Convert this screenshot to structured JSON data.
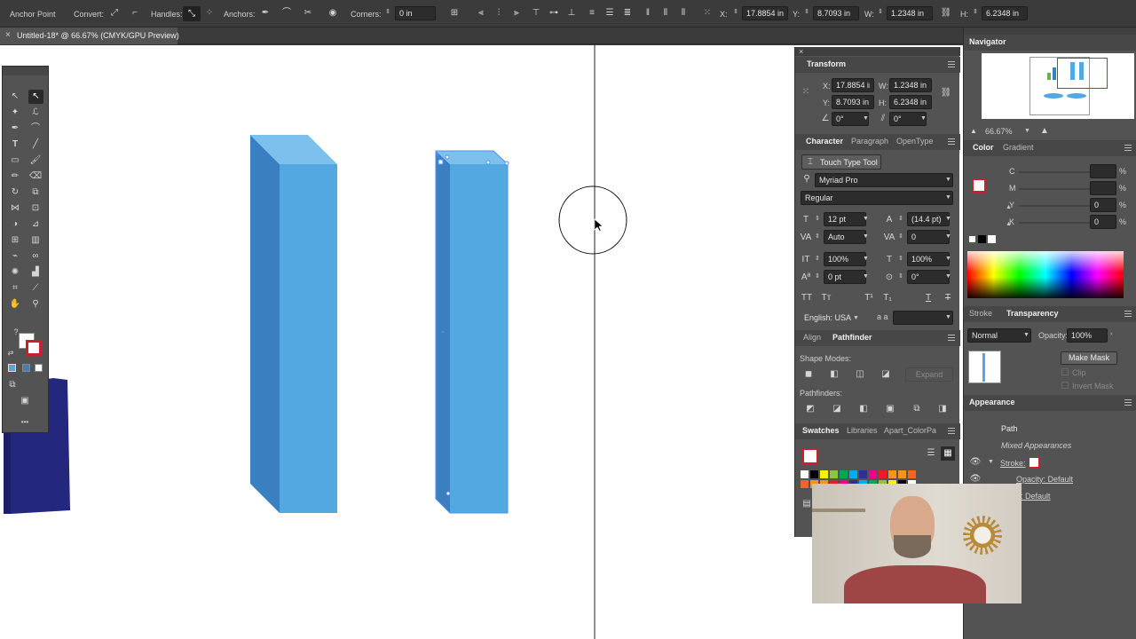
{
  "control_bar": {
    "selection_label": "Anchor Point",
    "convert_label": "Convert:",
    "handles_label": "Handles:",
    "anchors_label": "Anchors:",
    "corners_label": "Corners:",
    "corners_value": "0 in",
    "x_label": "X:",
    "x_value": "17.8854 in",
    "y_label": "Y:",
    "y_value": "8.7093 in",
    "w_label": "W:",
    "w_value": "1.2348 in",
    "h_label": "H:",
    "h_value": "6.2348 in"
  },
  "document_tab": {
    "title": "Untitled-18* @ 66.67% (CMYK/GPU Preview)",
    "close": "×"
  },
  "toolbar": {
    "more": "•••",
    "question": "?"
  },
  "transform": {
    "title": "Transform",
    "x_label": "X:",
    "x_value": "17.8854 in",
    "y_label": "Y:",
    "y_value": "8.7093 in",
    "w_label": "W:",
    "w_value": "1.2348 in",
    "h_label": "H:",
    "h_value": "6.2348 in",
    "angle_value": "0°",
    "shear_value": "0°"
  },
  "character": {
    "tabs": [
      "Character",
      "Paragraph",
      "OpenType"
    ],
    "touch_type_tool": "Touch Type Tool",
    "font_family": "Myriad Pro",
    "font_style": "Regular",
    "font_size": "12 pt",
    "leading": "(14.4 pt)",
    "kerning": "Auto",
    "tracking": "0",
    "vertical_scale": "100%",
    "horizontal_scale": "100%",
    "baseline_shift": "0 pt",
    "rotation": "0°",
    "language": "English: USA",
    "aa_label": "a a"
  },
  "pathfinder": {
    "tabs": [
      "Align",
      "Pathfinder"
    ],
    "shape_modes_label": "Shape Modes:",
    "expand_label": "Expand",
    "pathfinders_label": "Pathfinders:"
  },
  "swatches": {
    "tabs": [
      "Swatches",
      "Libraries",
      "Apart_ColorPa"
    ]
  },
  "navigator": {
    "title": "Navigator",
    "zoom": "66.67%"
  },
  "color": {
    "tabs": [
      "Color",
      "Gradient"
    ],
    "channels": [
      {
        "label": "C",
        "value": "",
        "unit": "%"
      },
      {
        "label": "M",
        "value": "",
        "unit": "%"
      },
      {
        "label": "Y",
        "value": "0",
        "unit": "%"
      },
      {
        "label": "K",
        "value": "0",
        "unit": "%"
      }
    ]
  },
  "transparency": {
    "tabs": [
      "Stroke",
      "Transparency"
    ],
    "blend_mode": "Normal",
    "opacity_label": "Opacity:",
    "opacity_value": "100%",
    "make_mask": "Make Mask",
    "clip_label": "Clip",
    "invert_mask_label": "Invert Mask"
  },
  "appearance": {
    "title": "Appearance",
    "object_type": "Path",
    "mixed": "Mixed Appearances",
    "stroke_label": "Stroke:",
    "opacity_row": "Opacity: Default",
    "second_row": ": Default"
  },
  "colors": {
    "bar_front": "#52a8e0",
    "bar_side": "#3a7fc0",
    "bar_top": "#7cc1ee",
    "navy": "#23287e"
  },
  "swatch_colors": [
    "#ffffff",
    "#000000",
    "#ffef00",
    "#8cc63f",
    "#00a651",
    "#00aeef",
    "#2e3192",
    "#ec008c",
    "#ed1c24",
    "#f7941d",
    "#f7941d",
    "#f26522"
  ]
}
